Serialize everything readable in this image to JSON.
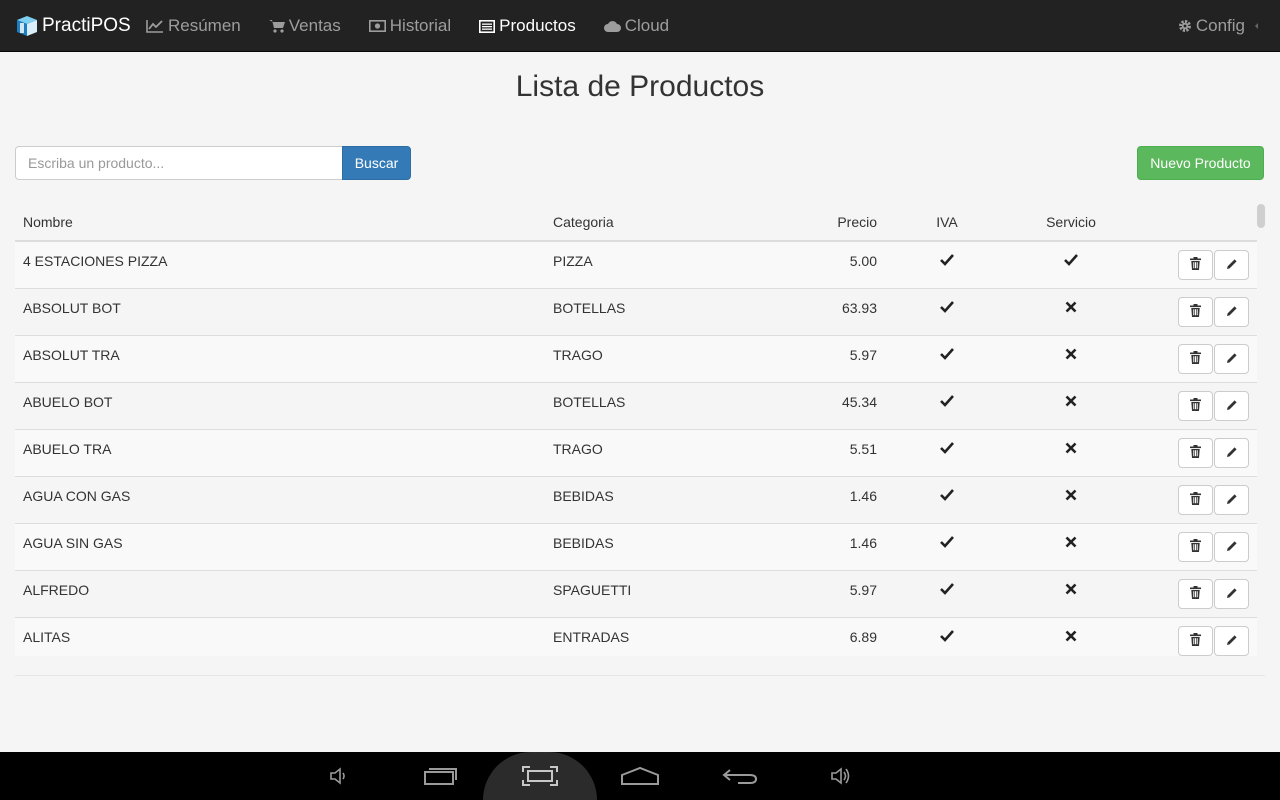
{
  "app": {
    "brand": "PractiPOS"
  },
  "nav": {
    "items": [
      {
        "label": "Resúmen",
        "icon": "line-chart-icon"
      },
      {
        "label": "Ventas",
        "icon": "cart-icon"
      },
      {
        "label": "Historial",
        "icon": "money-icon"
      },
      {
        "label": "Productos",
        "icon": "list-alt-icon",
        "active": true
      },
      {
        "label": "Cloud",
        "icon": "cloud-icon"
      }
    ],
    "config_label": "Config"
  },
  "page": {
    "title": "Lista de Productos"
  },
  "search": {
    "placeholder": "Escriba un producto...",
    "value": "",
    "button_label": "Buscar"
  },
  "new_product_label": "Nuevo Producto",
  "table": {
    "columns": [
      "Nombre",
      "Categoria",
      "Precio",
      "IVA",
      "Servicio"
    ],
    "rows": [
      {
        "name": "4 ESTACIONES PIZZA",
        "category": "PIZZA",
        "price": "5.00",
        "iva": true,
        "servicio": true
      },
      {
        "name": "ABSOLUT BOT",
        "category": "BOTELLAS",
        "price": "63.93",
        "iva": true,
        "servicio": false
      },
      {
        "name": "ABSOLUT TRA",
        "category": "TRAGO",
        "price": "5.97",
        "iva": true,
        "servicio": false
      },
      {
        "name": "ABUELO BOT",
        "category": "BOTELLAS",
        "price": "45.34",
        "iva": true,
        "servicio": false
      },
      {
        "name": "ABUELO TRA",
        "category": "TRAGO",
        "price": "5.51",
        "iva": true,
        "servicio": false
      },
      {
        "name": "AGUA CON GAS",
        "category": "BEBIDAS",
        "price": "1.46",
        "iva": true,
        "servicio": false
      },
      {
        "name": "AGUA SIN GAS",
        "category": "BEBIDAS",
        "price": "1.46",
        "iva": true,
        "servicio": false
      },
      {
        "name": "ALFREDO",
        "category": "SPAGUETTI",
        "price": "5.97",
        "iva": true,
        "servicio": false
      },
      {
        "name": "ALITAS",
        "category": "ENTRADAS",
        "price": "6.89",
        "iva": true,
        "servicio": false
      }
    ]
  },
  "system_bar": {
    "buttons": [
      "volume-down-icon",
      "recent-apps-icon",
      "screenshot-icon",
      "home-icon",
      "back-icon",
      "volume-up-icon"
    ]
  }
}
